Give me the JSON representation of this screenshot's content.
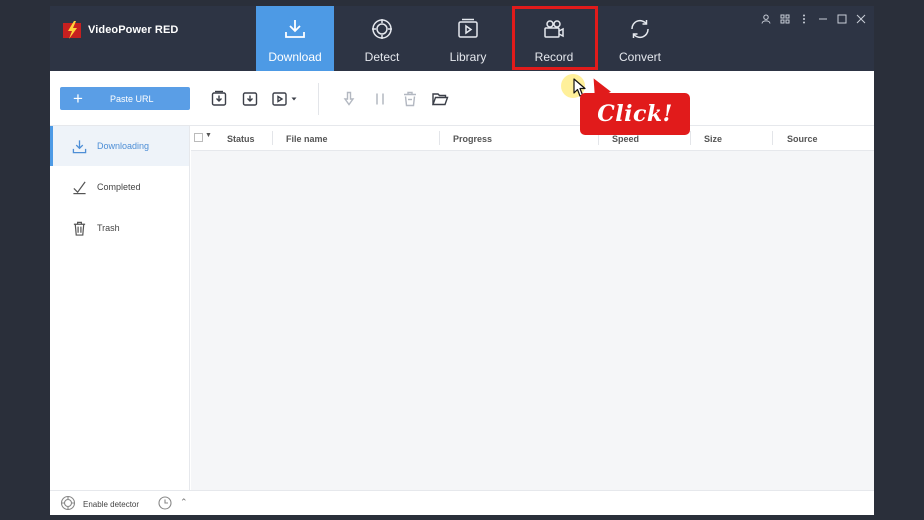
{
  "app": {
    "title": "VideoPower RED"
  },
  "tabs": [
    {
      "label": "Download",
      "icon": "download-icon",
      "active": true
    },
    {
      "label": "Detect",
      "icon": "target-icon",
      "active": false
    },
    {
      "label": "Library",
      "icon": "play-library-icon",
      "active": false
    },
    {
      "label": "Record",
      "icon": "camera-icon",
      "active": false
    },
    {
      "label": "Convert",
      "icon": "convert-icon",
      "active": false
    }
  ],
  "toolbar": {
    "paste_label": "Paste URL"
  },
  "sidebar": {
    "items": [
      {
        "label": "Downloading",
        "icon": "download-icon",
        "active": true
      },
      {
        "label": "Completed",
        "icon": "check-icon",
        "active": false
      },
      {
        "label": "Trash",
        "icon": "trash-icon",
        "active": false
      }
    ]
  },
  "table": {
    "columns": [
      "Status",
      "File name",
      "Progress",
      "Speed",
      "Size",
      "Source"
    ],
    "rows": []
  },
  "statusbar": {
    "detector_label": "Enable detector"
  },
  "annotation": {
    "callout_text": "Click!"
  },
  "colors": {
    "accent": "#4d9ae5",
    "titlebar": "#2d3444",
    "highlight": "#e11b1b"
  }
}
